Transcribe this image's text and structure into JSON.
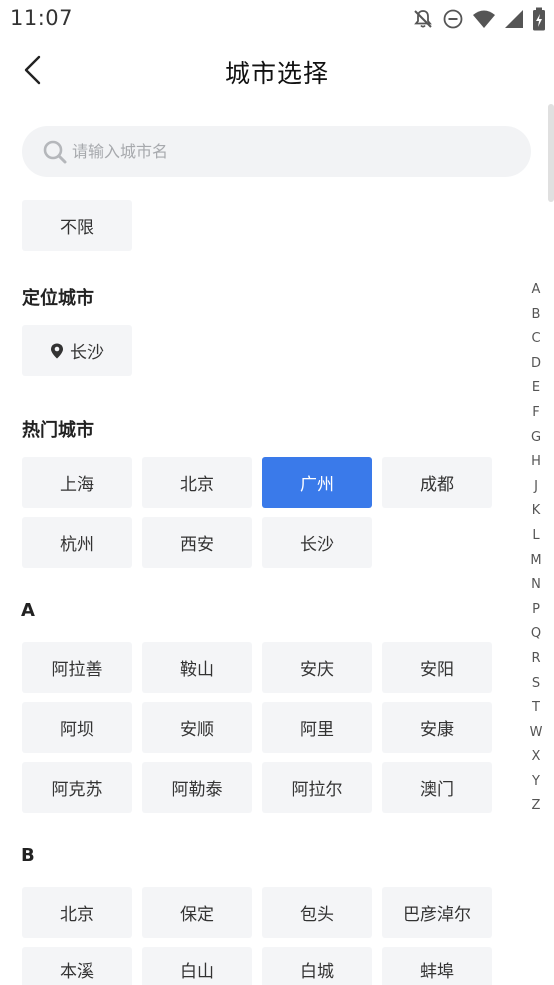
{
  "status_bar": {
    "time": "11:07",
    "icons": [
      "bell-off-icon",
      "do-not-disturb-icon",
      "wifi-icon",
      "signal-icon",
      "battery-charging-icon"
    ]
  },
  "nav": {
    "title": "城市选择",
    "back_icon": "chevron-left-icon"
  },
  "search": {
    "placeholder": "请输入城市名",
    "value": "",
    "icon": "search-icon"
  },
  "unlimited": {
    "label": "不限"
  },
  "location": {
    "title": "定位城市",
    "city": "长沙",
    "icon": "location-pin-icon"
  },
  "hot": {
    "title": "热门城市",
    "cities": [
      "上海",
      "北京",
      "广州",
      "成都",
      "杭州",
      "西安",
      "长沙"
    ],
    "selected": "广州"
  },
  "groups": [
    {
      "letter": "A",
      "cities": [
        "阿拉善",
        "鞍山",
        "安庆",
        "安阳",
        "阿坝",
        "安顺",
        "阿里",
        "安康",
        "阿克苏",
        "阿勒泰",
        "阿拉尔",
        "澳门"
      ]
    },
    {
      "letter": "B",
      "cities": [
        "北京",
        "保定",
        "包头",
        "巴彦淖尔",
        "本溪",
        "白山",
        "白城",
        "蚌埠"
      ]
    }
  ],
  "index_letters": [
    "A",
    "B",
    "C",
    "D",
    "E",
    "F",
    "G",
    "H",
    "J",
    "K",
    "L",
    "M",
    "N",
    "P",
    "Q",
    "R",
    "S",
    "T",
    "W",
    "X",
    "Y",
    "Z"
  ],
  "colors": {
    "accent": "#3a7aea",
    "chip_bg": "#f4f5f7",
    "search_bg": "#f2f3f5"
  }
}
